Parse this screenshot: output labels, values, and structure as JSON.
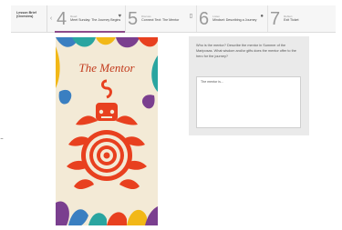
{
  "course": {
    "label": "Lesson Brief (Overview)"
  },
  "nav": {
    "back_icon": "chevron-left-icon"
  },
  "steps": [
    {
      "number": "4",
      "kind": "Read",
      "title": "Meet Sunday: The Journey Begins",
      "icon": "heart-icon",
      "active": true
    },
    {
      "number": "5",
      "kind": "Discuss",
      "title": "Connect Text: The Mentor",
      "icon": "book-icon",
      "active": false
    },
    {
      "number": "6",
      "kind": "Listen",
      "title": "Mindset: Describing a Journey",
      "icon": "pin-icon",
      "active": false
    },
    {
      "number": "7",
      "kind": "Reflect",
      "title": "Exit Ticket",
      "icon": "",
      "active": false
    }
  ],
  "cover": {
    "title": "The Mentor",
    "colors": {
      "background": "#f3ead6",
      "accent": "#e8401f",
      "blue": "#3a7fc1",
      "teal": "#2aa5a0",
      "yellow": "#f2b817",
      "purple": "#7a3f8f"
    }
  },
  "question": {
    "prompt": "Who is the mentor? Describe the mentor in Summer of the Mariposas. What wisdom and/or gifts does the mentor offer to the hero for the journey?",
    "answer": "The mentor is..."
  },
  "side_marker": "·-·",
  "accent_color": "#8d4a8a"
}
